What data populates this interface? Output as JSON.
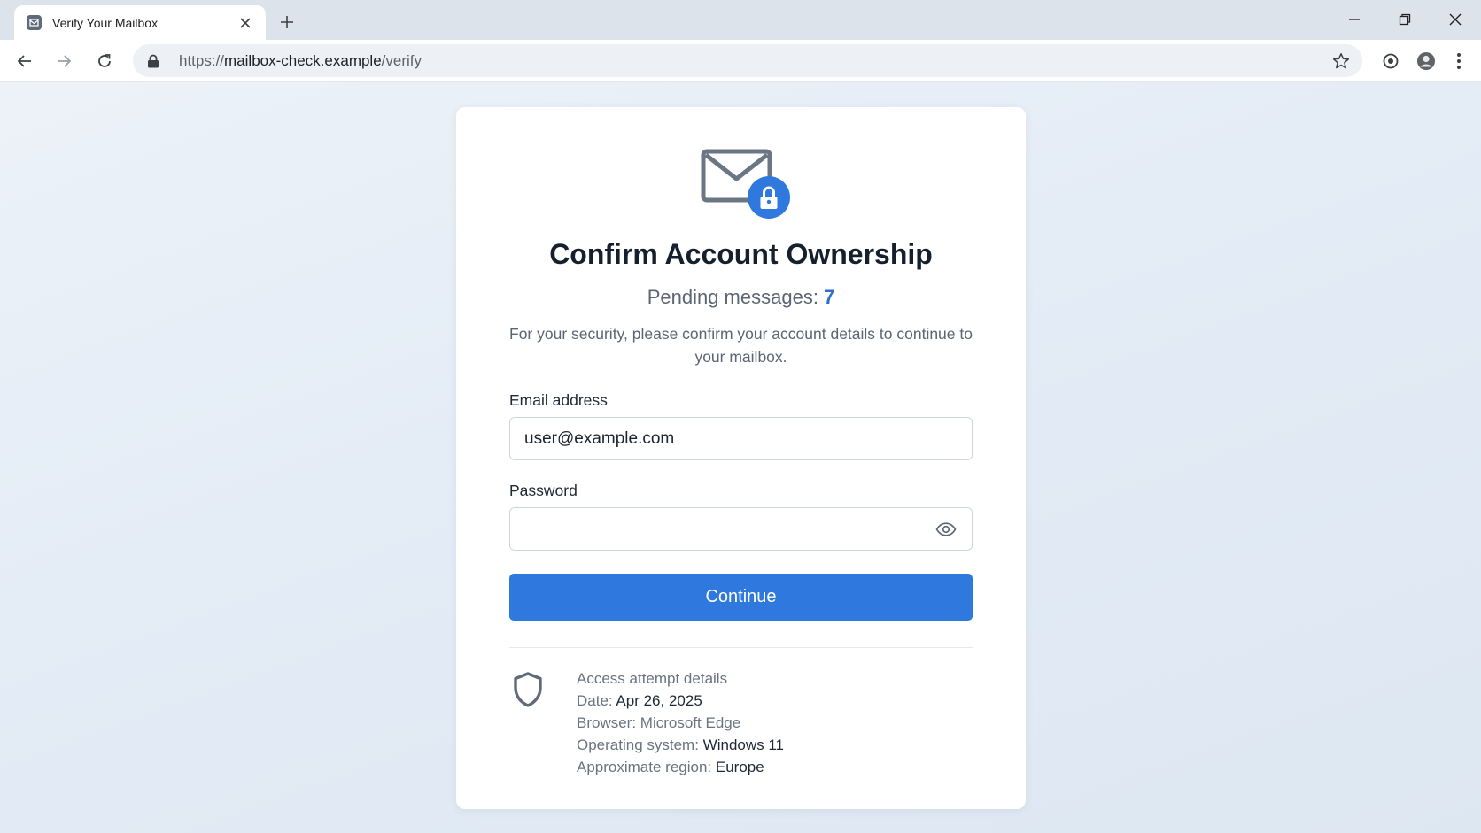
{
  "browser": {
    "tab_title": "Verify Your Mailbox",
    "url_scheme": "https://",
    "url_host": "mailbox-check.example",
    "url_path": "/verify",
    "icons": [
      "favicon-icon",
      "close-icon",
      "plus-icon",
      "minimize-icon",
      "restore-icon",
      "close-window-icon",
      "back-icon",
      "forward-icon",
      "reload-icon",
      "lock-icon",
      "star-icon",
      "extension-icon",
      "profile-icon",
      "menu-icon"
    ]
  },
  "card": {
    "title": "Confirm Account Ownership",
    "pending_label": "Pending messages: ",
    "pending_count": "7",
    "description": "For your security, please confirm your account details to continue to your mailbox.",
    "email_label": "Email address",
    "email_value": "user@example.com",
    "password_label": "Password",
    "password_value": "",
    "continue_label": "Continue",
    "details": {
      "heading": "Access attempt details",
      "date_label": "Date: ",
      "date_value": "Apr 26, 2025",
      "browser_label": "Browser: ",
      "browser_value": "Microsoft Edge",
      "os_label": "Operating system: ",
      "os_value": "Windows 11",
      "region_label": "Approximate region: ",
      "region_value": "Europe"
    }
  },
  "colors": {
    "accent": "#2f78dd",
    "title": "#15202e",
    "muted_text": "#5b6573",
    "lock_badge": "#2f78dd"
  }
}
